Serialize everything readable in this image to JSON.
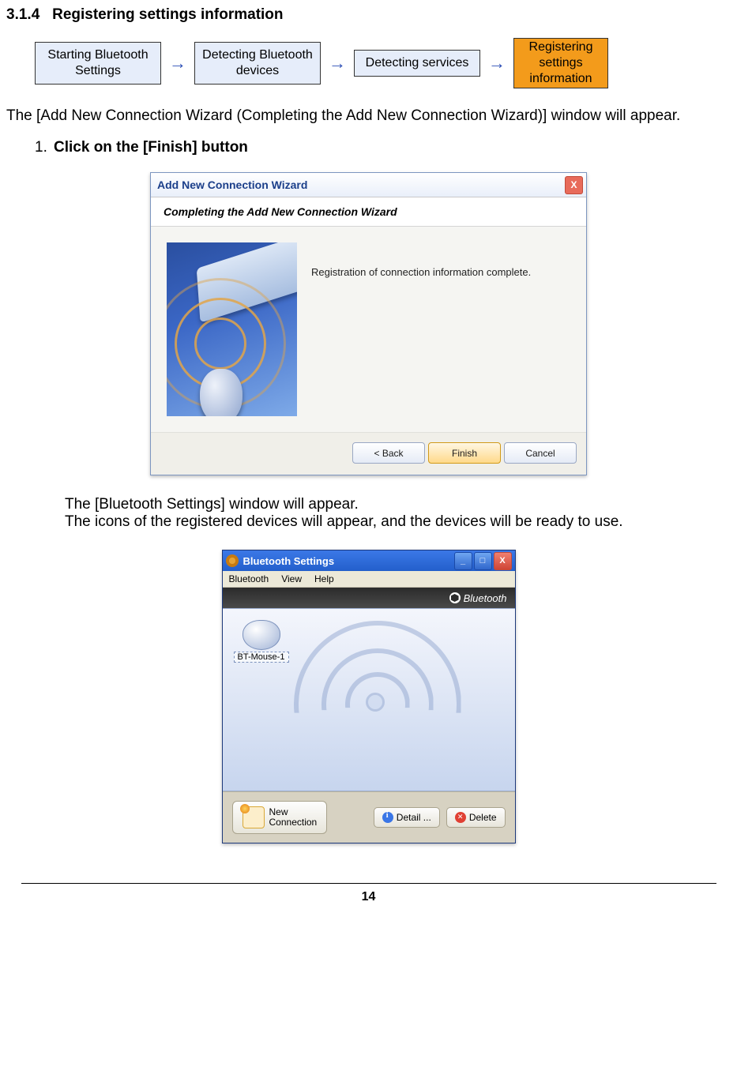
{
  "section": {
    "number": "3.1.4",
    "title": "Registering settings information"
  },
  "flow": {
    "step1": "Starting Bluetooth Settings",
    "step2": "Detecting Bluetooth devices",
    "step3": "Detecting services",
    "step4": "Registering settings information"
  },
  "intro": "The [Add New Connection Wizard (Completing the Add New Connection Wizard)] window will appear.",
  "step": {
    "number": "1.",
    "instruction": "Click on the [Finish] button"
  },
  "wizard": {
    "title": "Add New Connection Wizard",
    "heading": "Completing the Add New Connection Wizard",
    "message": "Registration of connection information complete.",
    "back": "< Back",
    "finish": "Finish",
    "cancel": "Cancel",
    "close": "X"
  },
  "after": {
    "line1": "The [Bluetooth Settings] window will appear.",
    "line2": "The icons of the registered devices will appear, and the devices will be ready to use."
  },
  "bt": {
    "title": "Bluetooth Settings",
    "menu": {
      "bluetooth": "Bluetooth",
      "view": "View",
      "help": "Help"
    },
    "brand": "Bluetooth",
    "device": "BT-Mouse-1",
    "newconn1": "New",
    "newconn2": "Connection",
    "detail": "Detail ...",
    "delete": "Delete",
    "min": "_",
    "max": "□",
    "close": "X"
  },
  "pageNumber": "14"
}
